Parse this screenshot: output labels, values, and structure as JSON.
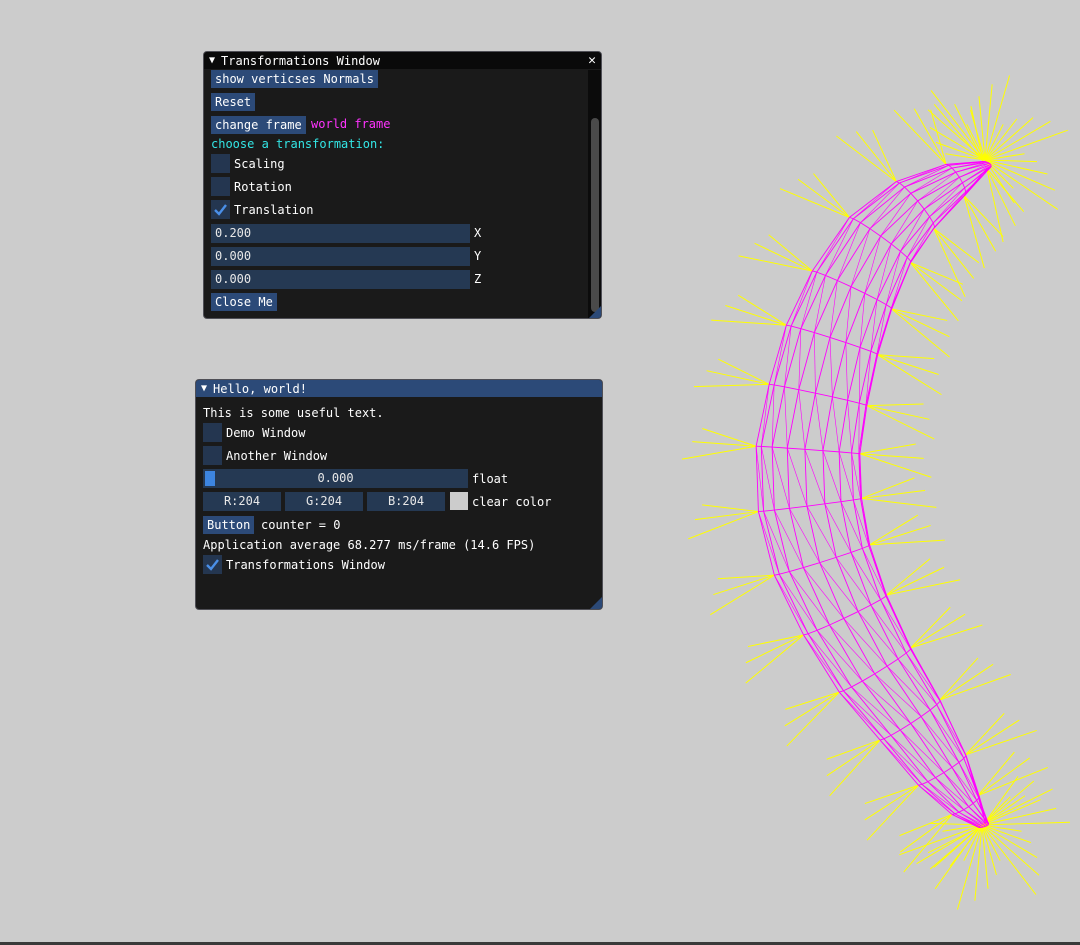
{
  "transform_window": {
    "title": "Transformations Window",
    "normals_button": "show verticses Normals",
    "reset_button": "Reset",
    "change_frame_button": "change frame",
    "frame_label": "world frame",
    "choose_label": "choose a transformation:",
    "options": [
      {
        "label": "Scaling",
        "checked": false
      },
      {
        "label": "Rotation",
        "checked": false
      },
      {
        "label": "Translation",
        "checked": true
      }
    ],
    "inputs": [
      {
        "value": "0.200",
        "axis": "X"
      },
      {
        "value": "0.000",
        "axis": "Y"
      },
      {
        "value": "0.000",
        "axis": "Z"
      }
    ],
    "close_button": "Close Me"
  },
  "hello_window": {
    "title": "Hello, world!",
    "text": "This is some useful text.",
    "demo_window": {
      "label": "Demo Window",
      "checked": false
    },
    "another_window": {
      "label": "Another Window",
      "checked": false
    },
    "slider": {
      "value": "0.000",
      "label": "float",
      "fraction": 0
    },
    "color": {
      "r": "R:204",
      "g": "G:204",
      "b": "B:204",
      "label": "clear color",
      "swatch": "#cccccc"
    },
    "button": "Button",
    "counter": "counter = 0",
    "fps_text": "Application average 68.277 ms/frame (14.6 FPS)",
    "transform_window_toggle": {
      "label": "Transformations Window",
      "checked": true
    }
  },
  "colors": {
    "background": "#cccccc",
    "mesh": "#ff00ff",
    "normals": "#ffff00",
    "title_active": "#2c4a78",
    "title_inactive": "#0a0a0a"
  }
}
